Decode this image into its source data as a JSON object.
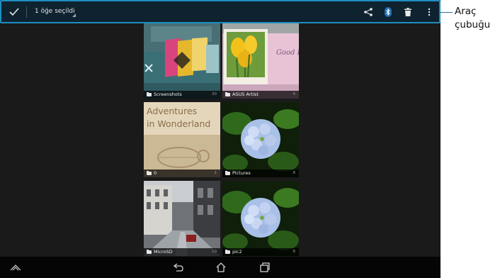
{
  "action_bar": {
    "selection_label": "1 öğe seçildi",
    "icons": [
      "checkmark-icon",
      "share-icon",
      "bluetooth-icon",
      "trash-icon",
      "overflow-menu-icon"
    ]
  },
  "albums": [
    {
      "name": "Screenshots",
      "count": "30",
      "selected": true
    },
    {
      "name": "ASUS Artist",
      "count": "4",
      "selected": false
    },
    {
      "name": "0",
      "count": "1",
      "selected": false
    },
    {
      "name": "Pictures",
      "count": "8",
      "selected": false
    },
    {
      "name": "MicroSD",
      "count": "10",
      "selected": false
    },
    {
      "name": "pic2",
      "count": "8",
      "selected": false
    }
  ],
  "thumb_text": {
    "asus_card": "Good Lu",
    "book_title_line1": "Adventures",
    "book_title_line2": "in Wonderland"
  },
  "callout": {
    "line1": "Araç",
    "line2": "çubuğu"
  },
  "colors": {
    "accent": "#33b5e5",
    "action_bar": "#0e2230"
  }
}
